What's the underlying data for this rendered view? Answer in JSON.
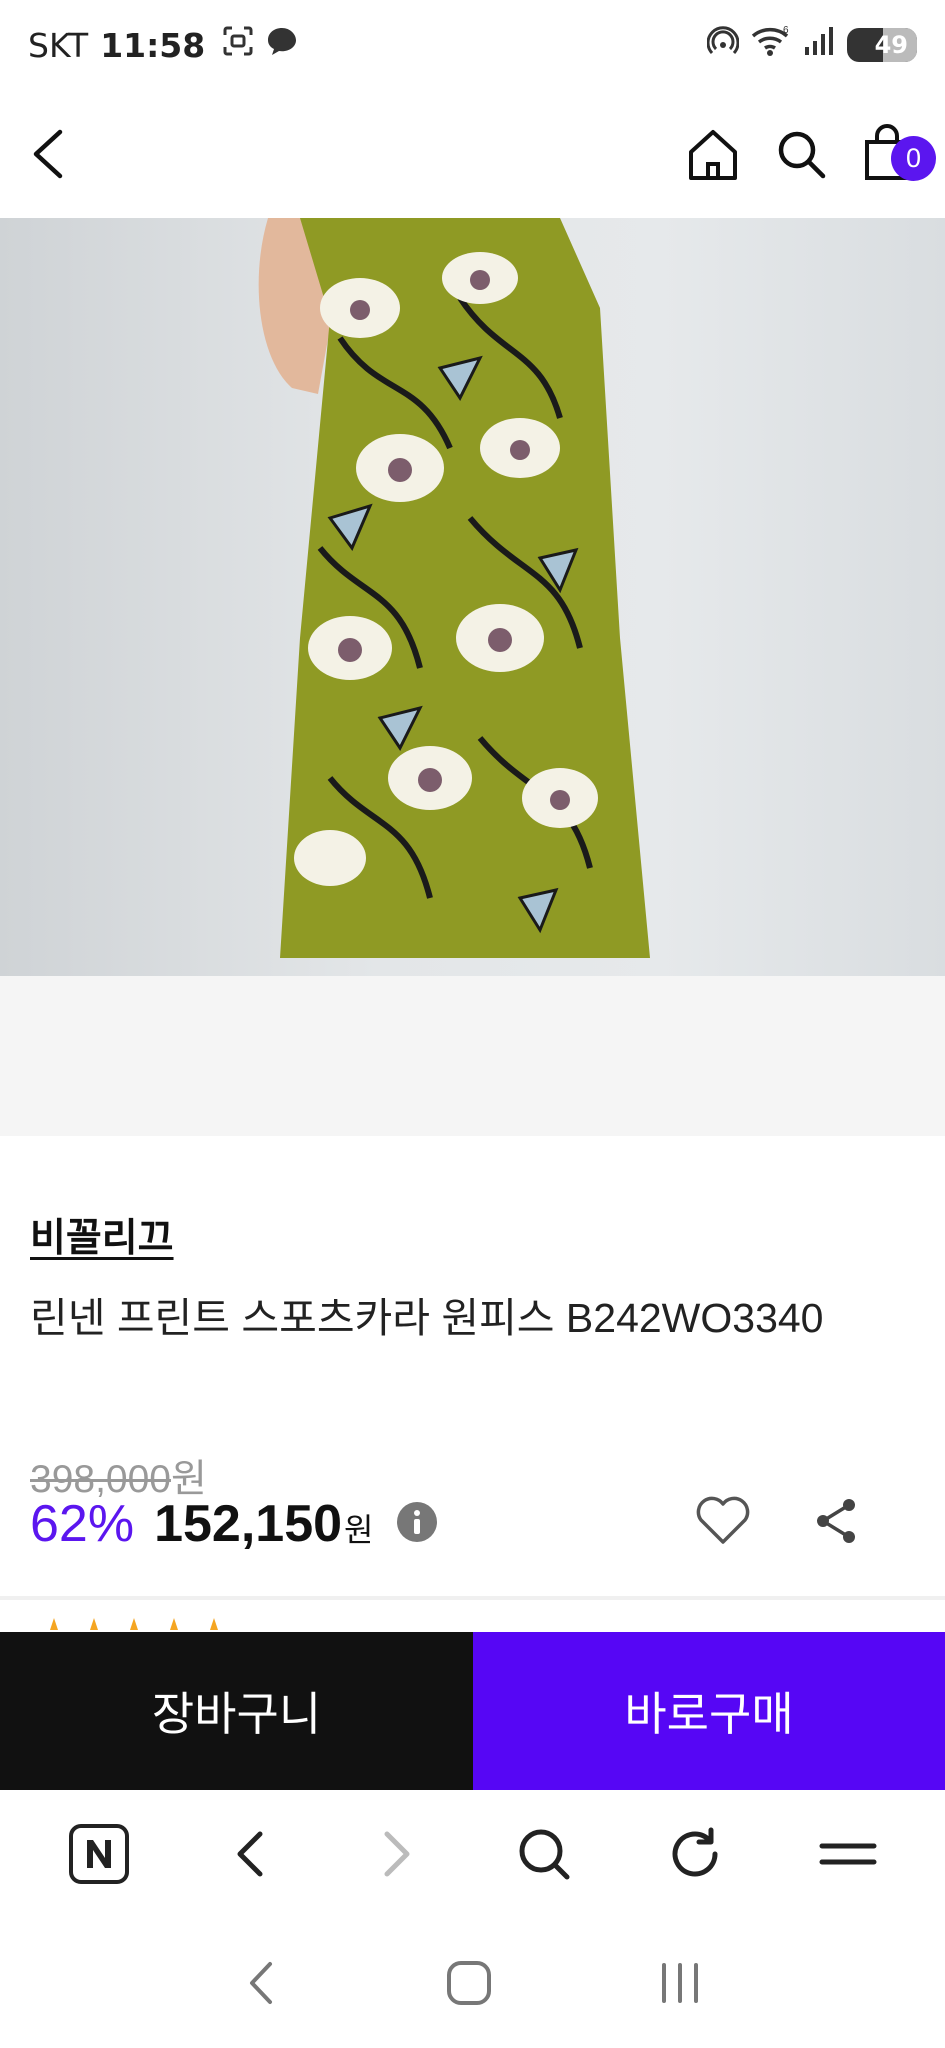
{
  "status_bar": {
    "carrier": "SKT",
    "time": "11:58",
    "battery": "49"
  },
  "header": {
    "cart_count": "0"
  },
  "product": {
    "brand": "비꼴리끄",
    "title": "린넨 프린트 스포츠카라 원피스 B242WO3340",
    "original_price": "398,000",
    "original_price_unit": "원",
    "discount": "62%",
    "sale_price": "152,150",
    "sale_price_unit": "원"
  },
  "buy_bar": {
    "cart_label": "장바구니",
    "buy_label": "바로구매"
  },
  "colors": {
    "accent": "#5b16ef",
    "buy_button": "#5606f5",
    "cart_button": "#111111"
  }
}
